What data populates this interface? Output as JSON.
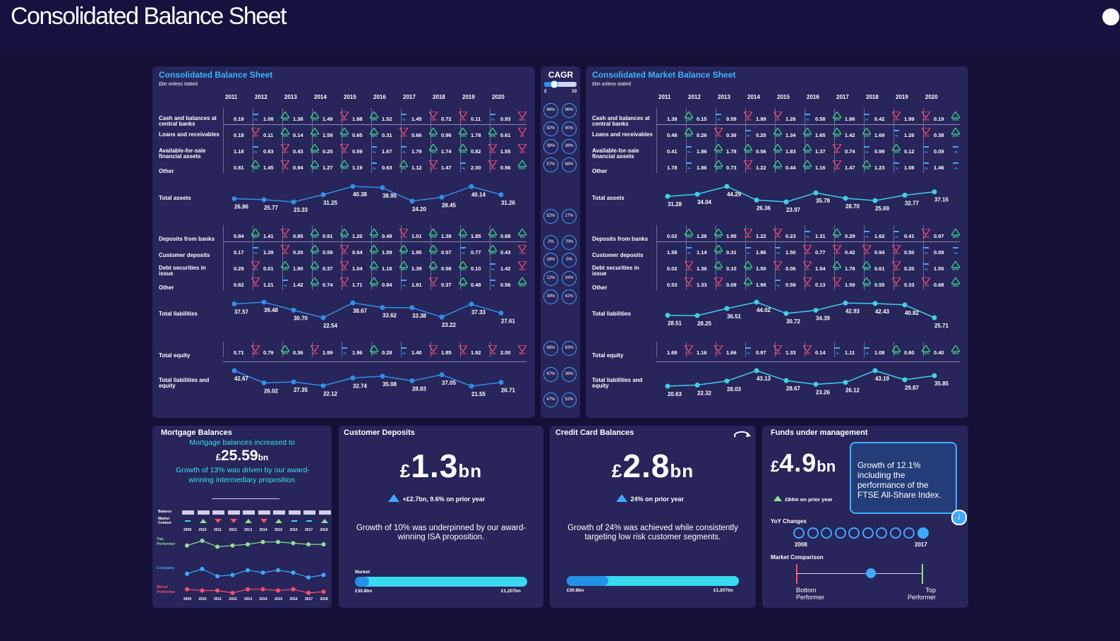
{
  "page": {
    "title": "Consolidated Balance Sheet"
  },
  "years": [
    "2011",
    "2012",
    "2013",
    "2014",
    "2015",
    "2016",
    "2017",
    "2018",
    "2019",
    "2020"
  ],
  "colors": {
    "up": "#3fd68c",
    "down": "#ff4d6d",
    "flat": "#3fa9ff",
    "line": "#2f8fe6",
    "line_market": "#3fd0e6"
  },
  "left_panel": {
    "title": "Consolidated Balance Sheet",
    "subtitle": "£bn unless stated",
    "rows": [
      {
        "label": "Cash and balances at central banks",
        "values": [
          "0.19",
          "1.08",
          "1.38",
          "1.49",
          "1.88",
          "1.52",
          "1.45",
          "0.72",
          "0.11",
          "0.93"
        ],
        "pcts": [
          "-%",
          "39%",
          "67%",
          "68%",
          "43%",
          "-%",
          "74%",
          "87%",
          "-%",
          "86%"
        ],
        "dirs": [
          "flat",
          "up",
          "up",
          "down",
          "up",
          "flat",
          "down",
          "down",
          "flat",
          "down"
        ]
      },
      {
        "label": "Loans and receivables",
        "values": [
          "0.18",
          "0.11",
          "0.14",
          "1.59",
          "0.65",
          "0.31",
          "0.66",
          "0.96",
          "1.78",
          "0.61"
        ],
        "pcts": [
          "25%",
          "51%",
          "0%",
          "84%",
          "38%",
          "40%",
          "59%",
          "23%",
          "56%",
          "4%"
        ],
        "dirs": [
          "down",
          "up",
          "up",
          "up",
          "up",
          "down",
          "up",
          "up",
          "up",
          "down"
        ]
      },
      {
        "label": "Available-for-sale financial assets",
        "values": [
          "1.18",
          "0.83",
          "0.43",
          "0.25",
          "0.59",
          "1.67",
          "1.79",
          "1.74",
          "0.82",
          "1.55"
        ],
        "pcts": [
          "-%",
          "40%",
          "100%",
          "68%",
          "-%",
          "-%",
          "72%",
          "81%",
          "61%",
          "32%"
        ],
        "dirs": [
          "flat",
          "down",
          "up",
          "down",
          "flat",
          "flat",
          "up",
          "up",
          "down",
          "down"
        ]
      },
      {
        "label": "Other",
        "values": [
          "0.81",
          "1.45",
          "0.94",
          "1.27",
          "1.19",
          "0.63",
          "1.12",
          "1.47",
          "2.00",
          "0.56"
        ],
        "pcts": [
          "76%",
          "37%",
          "83%",
          "75%",
          "-%",
          "2%",
          "87%",
          "-%",
          "74%",
          "61%"
        ],
        "dirs": [
          "up",
          "down",
          "up",
          "up",
          "flat",
          "up",
          "down",
          "flat",
          "down",
          "up"
        ]
      },
      {
        "label": "Deposits from banks",
        "values": [
          "0.84",
          "1.41",
          "0.85",
          "0.91",
          "1.20",
          "0.49",
          "1.01",
          "1.39",
          "1.85",
          "0.68"
        ],
        "pcts": [
          "99%",
          "24%",
          "16%",
          "82%",
          "13%",
          "67%",
          "80%",
          "10%",
          "18%",
          "8%"
        ],
        "dirs": [
          "up",
          "down",
          "up",
          "up",
          "up",
          "down",
          "up",
          "up",
          "up",
          "up"
        ]
      },
      {
        "label": "Customer deposits",
        "values": [
          "0.17",
          "1.39",
          "0.20",
          "0.59",
          "0.54",
          "1.59",
          "1.95",
          "0.57",
          "0.77",
          "0.43"
        ],
        "pcts": [
          "-%",
          "56%",
          "46%",
          "81%",
          "53%",
          "43%",
          "23%",
          "-%",
          "39%",
          "71%"
        ],
        "dirs": [
          "flat",
          "down",
          "up",
          "down",
          "up",
          "up",
          "up",
          "flat",
          "up",
          "down"
        ]
      },
      {
        "label": "Debt securities in issue",
        "values": [
          "0.29",
          "0.01",
          "1.90",
          "0.37",
          "1.04",
          "1.18",
          "1.39",
          "0.58",
          "0.10",
          "1.42"
        ],
        "pcts": [
          "8%",
          "12%",
          "33%",
          "97%",
          "47%",
          "46%",
          "28%",
          "33%",
          "-%",
          "25%"
        ],
        "dirs": [
          "down",
          "up",
          "up",
          "down",
          "up",
          "up",
          "up",
          "up",
          "flat",
          "down"
        ]
      },
      {
        "label": "Other",
        "values": [
          "0.62",
          "1.21",
          "1.42",
          "0.74",
          "1.71",
          "0.84",
          "1.81",
          "0.37",
          "0.49",
          "0.56"
        ],
        "pcts": [
          "11%",
          "-%",
          "22%",
          "37%",
          "85%",
          "-%",
          "74%",
          "78%",
          "-%",
          "82%"
        ],
        "dirs": [
          "down",
          "flat",
          "up",
          "down",
          "up",
          "flat",
          "down",
          "up",
          "flat",
          "up"
        ]
      },
      {
        "label": "Total equity",
        "values": [
          "0.71",
          "0.79",
          "0.36",
          "1.99",
          "1.96",
          "0.28",
          "1.40",
          "1.85",
          "1.92",
          "2.00"
        ],
        "pcts": [
          "46%",
          "86%",
          "31%",
          "-%",
          "82%",
          "-%",
          "80%",
          "74%",
          "74%",
          "86%"
        ],
        "dirs": [
          "down",
          "up",
          "down",
          "flat",
          "up",
          "flat",
          "down",
          "down",
          "down",
          "down"
        ]
      }
    ],
    "total_assets": {
      "label": "Total assets",
      "values": [
        "26.86",
        "25.77",
        "23.33",
        "31.25",
        "40.38",
        "38.95",
        "24.20",
        "28.45",
        "40.14",
        "31.26"
      ]
    },
    "total_liabilities": {
      "label": "Total liabilities",
      "values": [
        "37.57",
        "39.48",
        "30.70",
        "22.54",
        "38.67",
        "33.62",
        "33.38",
        "23.22",
        "37.33",
        "27.61"
      ]
    },
    "total_le": {
      "label": "Total liabilities and equity",
      "values": [
        "42.67",
        "26.02",
        "27.35",
        "22.12",
        "32.74",
        "35.08",
        "28.83",
        "37.05",
        "21.55",
        "26.71"
      ]
    }
  },
  "right_panel": {
    "title": "Consolidated Market Balance Sheet",
    "subtitle": "£bn unless stated",
    "rows": [
      {
        "label": "Cash and balances at central banks",
        "values": [
          "1.38",
          "0.15",
          "0.59",
          "1.99",
          "1.26",
          "0.58",
          "1.86",
          "0.42",
          "1.99",
          "0.19"
        ],
        "pcts": [
          "12%",
          "-%",
          "15%",
          "1%",
          "-%",
          "82%",
          "-%",
          "57%",
          "86%",
          "93%"
        ],
        "dirs": [
          "up",
          "flat",
          "down",
          "down",
          "flat",
          "up",
          "flat",
          "down",
          "down",
          "up"
        ]
      },
      {
        "label": "Loans and receivables",
        "values": [
          "0.48",
          "0.26",
          "0.36",
          "0.25",
          "1.34",
          "1.65",
          "1.42",
          "1.69",
          "1.26",
          "0.38"
        ],
        "pcts": [
          "55%",
          "78%",
          "-%",
          "20%",
          "99%",
          "26%",
          "11%",
          "-%",
          "13%",
          "22%"
        ],
        "dirs": [
          "up",
          "down",
          "flat",
          "up",
          "up",
          "up",
          "up",
          "flat",
          "down",
          "up"
        ]
      },
      {
        "label": "Available-for-sale financial assets",
        "values": [
          "0.41",
          "1.86",
          "1.78",
          "0.56",
          "1.83",
          "1.37",
          "0.74",
          "0.99",
          "0.12",
          "0.09"
        ],
        "pcts": [
          "-%",
          "22%",
          "50%",
          "43%",
          "89%",
          "99%",
          "-%",
          "15%",
          "-%",
          "-%"
        ],
        "dirs": [
          "flat",
          "up",
          "up",
          "up",
          "up",
          "down",
          "flat",
          "up",
          "flat",
          "flat"
        ]
      },
      {
        "label": "Other",
        "values": [
          "1.78",
          "1.86",
          "0.73",
          "1.22",
          "0.44",
          "1.16",
          "1.47",
          "1.23",
          "1.08",
          "1.46"
        ],
        "pcts": [
          "-%",
          "56%",
          "13%",
          "57%",
          "66%",
          "26%",
          "11%",
          "-%",
          "-%",
          "-%"
        ],
        "dirs": [
          "flat",
          "up",
          "down",
          "up",
          "up",
          "down",
          "up",
          "flat",
          "flat",
          "flat"
        ]
      },
      {
        "label": "Deposits from banks",
        "values": [
          "0.02",
          "1.26",
          "1.95",
          "1.22",
          "0.23",
          "1.31",
          "0.29",
          "1.62",
          "0.41",
          "0.97"
        ],
        "pcts": [
          "70%",
          "81%",
          "65%",
          "87%",
          "-%",
          "8%",
          "-%",
          "-%",
          "86%",
          "44%"
        ],
        "dirs": [
          "up",
          "up",
          "down",
          "down",
          "flat",
          "up",
          "flat",
          "flat",
          "down",
          "up"
        ]
      },
      {
        "label": "Customer deposits",
        "values": [
          "1.58",
          "1.14",
          "0.31",
          "1.86",
          "1.50",
          "0.77",
          "0.42",
          "0.94",
          "0.50",
          "0.09"
        ],
        "pcts": [
          "-%",
          "45%",
          "-%",
          "-%",
          "58%",
          "14%",
          "64%",
          "93%",
          "-%",
          "-%"
        ],
        "dirs": [
          "flat",
          "up",
          "flat",
          "flat",
          "down",
          "down",
          "down",
          "down",
          "flat",
          "flat"
        ]
      },
      {
        "label": "Debt securities in issue",
        "values": [
          "0.02",
          "1.36",
          "0.10",
          "1.50",
          "0.06",
          "1.54",
          "1.78",
          "0.61",
          "0.20",
          "1.50"
        ],
        "pcts": [
          "43%",
          "73%",
          "32%",
          "5%",
          "1%",
          "5%",
          "40%",
          "83%",
          "-%",
          "57%"
        ],
        "dirs": [
          "down",
          "up",
          "up",
          "down",
          "down",
          "up",
          "up",
          "down",
          "flat",
          "up"
        ]
      },
      {
        "label": "Other",
        "values": [
          "0.53",
          "1.33",
          "0.09",
          "1.98",
          "0.59",
          "0.13",
          "1.59",
          "0.55",
          "0.33",
          "0.68"
        ],
        "pcts": [
          "84%",
          "83%",
          "7%",
          "-%",
          "87%",
          "31%",
          "93%",
          "4%",
          "77%",
          "25%"
        ],
        "dirs": [
          "down",
          "down",
          "up",
          "flat",
          "down",
          "down",
          "up",
          "down",
          "down",
          "up"
        ]
      },
      {
        "label": "Total equity",
        "values": [
          "1.69",
          "1.16",
          "1.66",
          "0.97",
          "1.33",
          "0.14",
          "1.11",
          "1.08",
          "0.60",
          "0.40"
        ],
        "pcts": [
          "27%",
          "13%",
          "-%",
          "80%",
          "79%",
          "-%",
          "-%",
          "85%",
          "22%",
          "99%"
        ],
        "dirs": [
          "down",
          "down",
          "flat",
          "down",
          "down",
          "flat",
          "flat",
          "up",
          "up",
          "up"
        ]
      }
    ],
    "total_assets": {
      "label": "Total assets",
      "values": [
        "31.28",
        "34.04",
        "44.29",
        "26.36",
        "23.97",
        "35.78",
        "28.70",
        "25.69",
        "32.77",
        "37.15"
      ]
    },
    "total_liabilities": {
      "label": "Total liabilities",
      "values": [
        "28.51",
        "28.25",
        "36.51",
        "44.02",
        "30.72",
        "34.39",
        "42.93",
        "42.43",
        "40.82",
        "25.71"
      ]
    },
    "total_le": {
      "label": "Total liabilities and equity",
      "values": [
        "20.63",
        "22.32",
        "28.03",
        "43.13",
        "28.67",
        "23.26",
        "26.12",
        "43.19",
        "29.87",
        "35.85"
      ]
    }
  },
  "cagr": {
    "title": "CAGR",
    "slider_min": "2",
    "slider_max": "10",
    "slider_value": 0.3,
    "pairs": [
      [
        "86%",
        "96%"
      ],
      [
        "92%",
        "90%"
      ],
      [
        "38%",
        "38%"
      ],
      [
        "57%",
        "68%"
      ],
      [
        "52%",
        "17%"
      ],
      [
        "2%",
        "70%"
      ],
      [
        "16%",
        "0%"
      ],
      [
        "12%",
        "34%"
      ],
      [
        "39%",
        "42%"
      ],
      [
        "66%",
        "83%"
      ],
      [
        "67%",
        "38%"
      ],
      [
        "47%",
        "52%"
      ]
    ]
  },
  "mortgage": {
    "title": "Mortgage Balances",
    "line1": "Mortgage balances increased to",
    "currency": "£",
    "value": "25.59",
    "unit": "bn",
    "text": "Growth of 13% was driven by our award-winning intermediary proposition.",
    "table_labels": [
      "Balance",
      "Market Context"
    ],
    "years": [
      "2009",
      "2010",
      "2011",
      "2012",
      "2013",
      "2014",
      "2015",
      "2016",
      "2017",
      "2018"
    ],
    "dirs": [
      "flat",
      "up",
      "down",
      "down",
      "up",
      "down",
      "up",
      "flat",
      "flat",
      "up"
    ],
    "series_labels": [
      "Top Performer",
      "Company",
      "Worst Performer"
    ],
    "top": [
      3,
      5,
      2.5,
      3,
      3.5,
      4.5,
      4.5,
      4,
      3.5,
      3.5
    ],
    "company": [
      3,
      5,
      2,
      2.5,
      4.5,
      3.5,
      4.5,
      3.5,
      1.5,
      2.5
    ],
    "worst": [
      3,
      2.5,
      2.5,
      1.5,
      3,
      3,
      2.5,
      3,
      1.5,
      2
    ]
  },
  "deposits": {
    "title": "Customer Deposits",
    "currency": "£",
    "value": "1.3",
    "unit": "bn",
    "delta": "+£2.7bn, 9.6% on prior year",
    "text": "Growth of 10% was underpinned by our award-winning ISA proposition.",
    "bar_label": "Market",
    "bar_min": "£30.8bn",
    "bar_max": "£1,207bn",
    "bar_fill": 0.08
  },
  "credit": {
    "title": "Credit Card Balances",
    "currency": "£",
    "value": "2.8",
    "unit": "bn",
    "delta": "24% on prior year",
    "text": "Growth of 24% was achieved while consistently targeting low risk customer segments.",
    "bar_min": "£30.8bn",
    "bar_max": "£1,207bn",
    "bar_fill": 0.24
  },
  "funds": {
    "title": "Funds under management",
    "currency": "£",
    "value": "4.9",
    "unit": "bn",
    "delta": "£84m on prior year",
    "note": "Growth of 12.1% including the performance of the FTSE All-Share Index.",
    "yoy_label": "YoY Changes",
    "yoy_start": "2008",
    "yoy_end": "2017",
    "yoy_selected": 9,
    "market_label": "Market Comparison",
    "bottom_label": "Bottom Performer",
    "top_label": "Top Performer",
    "market_position": 0.59
  }
}
